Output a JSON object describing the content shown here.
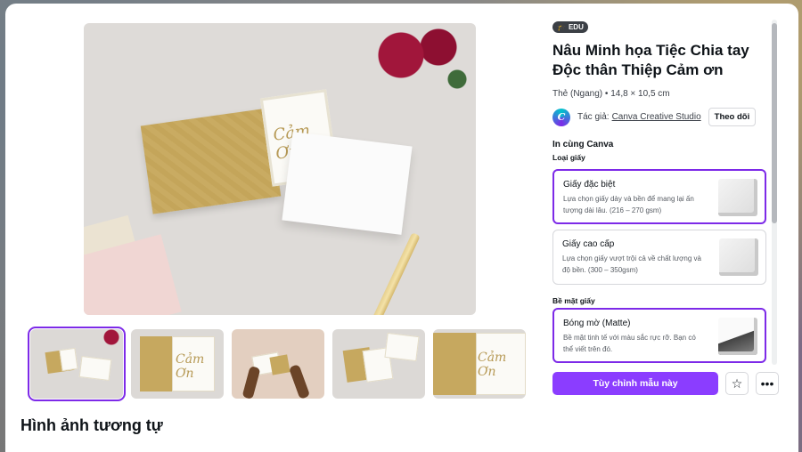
{
  "product": {
    "badge": "EDU",
    "title": "Nâu Minh họa Tiệc Chia tay Độc thân Thiệp Cảm ơn",
    "subtitle": "Thẻ (Ngang) • 14,8 × 10,5 cm",
    "card_text": "Cảm Ơn"
  },
  "author": {
    "label": "Tác giả:",
    "name": "Canva Creative Studio",
    "follow_label": "Theo dõi"
  },
  "print": {
    "section_title": "In cùng Canva",
    "paper_type_label": "Loại giấy",
    "paper_options": [
      {
        "name": "Giấy đặc biệt",
        "desc": "Lựa chọn giấy dày và bền để mang lại ấn tượng dài lâu. (216 – 270 gsm)"
      },
      {
        "name": "Giấy cao cấp",
        "desc": "Lựa chọn giấy vượt trội cả về chất lượng và độ bền. (300 – 350gsm)"
      }
    ],
    "surface_label": "Bề mặt giấy",
    "surface_options": [
      {
        "name": "Bóng mờ (Matte)",
        "desc": "Bề mặt tinh tế với màu sắc rực rỡ. Bạn có thể viết trên đó."
      }
    ]
  },
  "actions": {
    "customize_label": "Tùy chỉnh mẫu này",
    "favorite_icon": "star-icon",
    "more_icon": "more-icon"
  },
  "similar_title": "Hình ảnh tương tự",
  "colors": {
    "accent": "#8b3dff",
    "selected_border": "#7d2ae8"
  }
}
